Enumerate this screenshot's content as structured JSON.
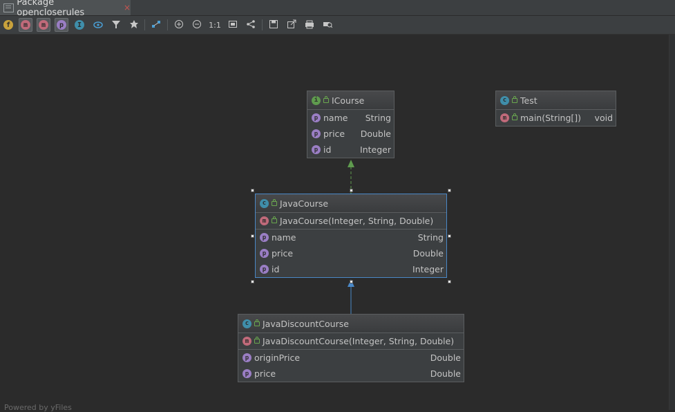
{
  "tab": {
    "title": "Package opencloserules",
    "close": "×"
  },
  "toolbar": {
    "buttons": [
      {
        "icon": "fields-filter-icon",
        "glyph": "f"
      },
      {
        "icon": "constructors-filter-icon",
        "glyph": "m"
      },
      {
        "icon": "methods-filter-icon",
        "glyph": "m"
      },
      {
        "icon": "properties-filter-icon",
        "glyph": "p"
      },
      {
        "icon": "inner-classes-filter-icon",
        "glyph": "I"
      },
      {
        "icon": "visibility-icon",
        "glyph": ""
      },
      {
        "icon": "filter-icon",
        "glyph": ""
      },
      {
        "icon": "pin-icon",
        "glyph": ""
      },
      {
        "icon": "edge-mode-icon",
        "glyph": ""
      },
      {
        "icon": "zoom-in-icon",
        "glyph": "⊕"
      },
      {
        "icon": "zoom-out-icon",
        "glyph": "⊖"
      },
      {
        "icon": "actual-size-icon",
        "glyph": "1:1"
      },
      {
        "icon": "fit-content-icon",
        "glyph": ""
      },
      {
        "icon": "layout-icon",
        "glyph": ""
      },
      {
        "icon": "save-icon",
        "glyph": ""
      },
      {
        "icon": "export-icon",
        "glyph": ""
      },
      {
        "icon": "print-icon",
        "glyph": ""
      },
      {
        "icon": "print-preview-icon",
        "glyph": ""
      }
    ]
  },
  "diagram": {
    "icourse": {
      "kind": "I",
      "name": "ICourse",
      "fields": [
        {
          "kind": "p",
          "name": "name",
          "type": "String"
        },
        {
          "kind": "p",
          "name": "price",
          "type": "Double"
        },
        {
          "kind": "p",
          "name": "id",
          "type": "Integer"
        }
      ]
    },
    "test": {
      "kind": "C",
      "name": "Test",
      "methods": [
        {
          "kind": "m",
          "name": "main(String[])",
          "type": "void"
        }
      ]
    },
    "javacourse": {
      "kind": "C",
      "name": "JavaCourse",
      "constructors": [
        {
          "kind": "m",
          "name": "JavaCourse(Integer, String, Double)",
          "type": ""
        }
      ],
      "fields": [
        {
          "kind": "p",
          "name": "name",
          "type": "String"
        },
        {
          "kind": "p",
          "name": "price",
          "type": "Double"
        },
        {
          "kind": "p",
          "name": "id",
          "type": "Integer"
        }
      ]
    },
    "javadiscount": {
      "kind": "C",
      "name": "JavaDiscountCourse",
      "constructors": [
        {
          "kind": "m",
          "name": "JavaDiscountCourse(Integer, String, Double)",
          "type": ""
        }
      ],
      "fields": [
        {
          "kind": "p",
          "name": "originPrice",
          "type": "Double"
        },
        {
          "kind": "p",
          "name": "price",
          "type": "Double"
        }
      ]
    }
  },
  "colors": {
    "background": "#2b2b2b",
    "node": "#3c3f41",
    "selection": "#4a88c7",
    "implements_arrow": "#5f9b4e",
    "extends_arrow": "#4a88c7"
  },
  "watermark": "Powered by yFiles"
}
